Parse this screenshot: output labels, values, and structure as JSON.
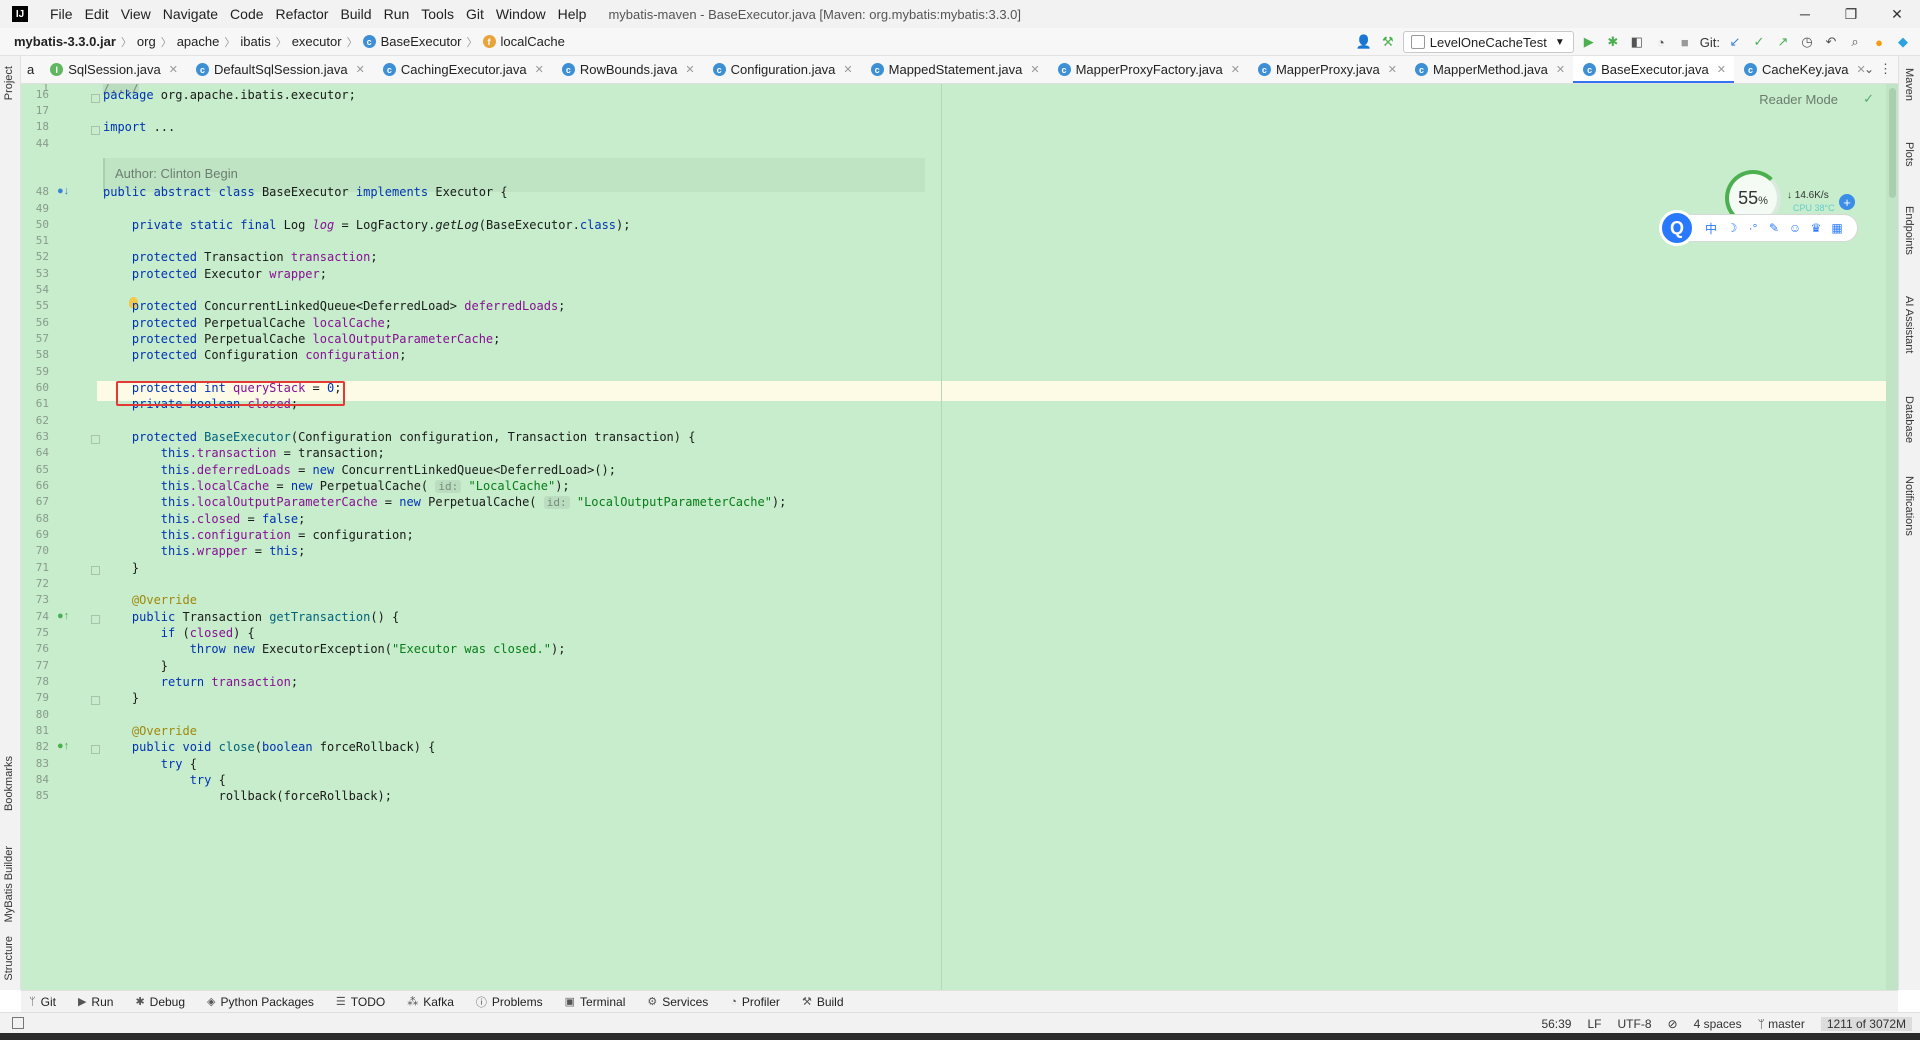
{
  "titlebar": {
    "logo": "IJ",
    "menu": [
      "File",
      "Edit",
      "View",
      "Navigate",
      "Code",
      "Refactor",
      "Build",
      "Run",
      "Tools",
      "Git",
      "Window",
      "Help"
    ],
    "window_title": "mybatis-maven - BaseExecutor.java [Maven: org.mybatis:mybatis:3.3.0]",
    "minimize": "─",
    "restore": "❐",
    "close": "✕"
  },
  "breadcrumb": {
    "jar": "mybatis-3.3.0.jar",
    "parts": [
      "org",
      "apache",
      "ibatis",
      "executor"
    ],
    "class_name": "BaseExecutor",
    "field_name": "localCache"
  },
  "toolbar": {
    "run_config": "LevelOneCacheTest",
    "git_label": "Git:"
  },
  "left_tools": [
    "Project",
    "Bookmarks",
    "MyBatis Builder",
    "Structure"
  ],
  "right_tools": [
    "Maven",
    "Plots",
    "Endpoints",
    "AI Assistant",
    "Database",
    "Notifications"
  ],
  "tabs": {
    "fragment": "a",
    "items": [
      {
        "label": "SqlSession.java",
        "active": false
      },
      {
        "label": "DefaultSqlSession.java",
        "active": false
      },
      {
        "label": "CachingExecutor.java",
        "active": false
      },
      {
        "label": "RowBounds.java",
        "active": false
      },
      {
        "label": "Configuration.java",
        "active": false
      },
      {
        "label": "MappedStatement.java",
        "active": false
      },
      {
        "label": "MapperProxyFactory.java",
        "active": false
      },
      {
        "label": "MapperProxy.java",
        "active": false
      },
      {
        "label": "MapperMethod.java",
        "active": false
      },
      {
        "label": "BaseExecutor.java",
        "active": true
      },
      {
        "label": "CacheKey.java",
        "active": false
      }
    ]
  },
  "editor": {
    "reader_mode": "Reader Mode",
    "author": "Author: Clinton Begin",
    "line_numbers": {
      "l1": "1",
      "l16": "16",
      "l17": "17",
      "l18": "18",
      "l44": "44",
      "l48": "48",
      "l49": "49",
      "l50": "50",
      "l51": "51",
      "l52": "52",
      "l53": "53",
      "l54": "54",
      "l55": "55",
      "l56": "56",
      "l57": "57",
      "l58": "58",
      "l59": "59",
      "l60": "60",
      "l61": "61",
      "l62": "62",
      "l63": "63",
      "l64": "64",
      "l65": "65",
      "l66": "66",
      "l67": "67",
      "l68": "68",
      "l69": "69",
      "l70": "70",
      "l71": "71",
      "l72": "72",
      "l73": "73",
      "l74": "74",
      "l75": "75",
      "l76": "76",
      "l77": "77",
      "l78": "78",
      "l79": "79",
      "l80": "80",
      "l81": "81",
      "l82": "82",
      "l83": "83",
      "l84": "84",
      "l85": "85"
    },
    "code": {
      "c1": "/.../",
      "c16_kw": "package",
      "c16_rest": " org.apache.ibatis.executor;",
      "c18_kw": "import",
      "c18_rest": " ...",
      "c48_kw1": "public abstract class",
      "c48_mid": " BaseExecutor ",
      "c48_kw2": "implements",
      "c48_rest": " Executor {",
      "c50_kw": "private static final",
      "c50_type": " Log ",
      "c50_fld": "log",
      "c50_eq": " = LogFactory.",
      "c50_m": "getLog",
      "c50_arg": "(BaseExecutor.",
      "c50_kw2": "class",
      "c50_end": ");",
      "c52_kw": "protected",
      "c52_type": " Transaction ",
      "c52_fld": "transaction",
      "c52_end": ";",
      "c53_kw": "protected",
      "c53_type": " Executor ",
      "c53_fld": "wrapper",
      "c53_end": ";",
      "c55_kw": "protected",
      "c55_type": " ConcurrentLinkedQueue<DeferredLoad> ",
      "c55_fld": "deferredLoads",
      "c55_end": ";",
      "c56_kw": "protected",
      "c56_type": " PerpetualCache ",
      "c56_fld": "localCache",
      "c56_end": ";",
      "c57_kw": "protected",
      "c57_type": " PerpetualCache ",
      "c57_fld": "localOutputParameterCache",
      "c57_end": ";",
      "c58_kw": "protected",
      "c58_type": " Configuration ",
      "c58_fld": "configuration",
      "c58_end": ";",
      "c60_kw": "protected int",
      "c60_fld": " queryStack",
      "c60_eq": " = ",
      "c60_num": "0",
      "c60_end": ";",
      "c61_kw": "private boolean",
      "c61_fld": " closed",
      "c61_end": ";",
      "c63_kw": "protected",
      "c63_m": " BaseExecutor",
      "c63_rest": "(Configuration configuration, Transaction transaction) {",
      "c64_kw": "this",
      "c64_fld": ".transaction",
      "c64_rest": " = transaction;",
      "c65_kw": "this",
      "c65_fld": ".deferredLoads",
      "c65_eq": " = ",
      "c65_kw2": "new",
      "c65_rest": " ConcurrentLinkedQueue<DeferredLoad>();",
      "c66_kw": "this",
      "c66_fld": ".localCache",
      "c66_eq": " = ",
      "c66_kw2": "new",
      "c66_rest": " PerpetualCache( ",
      "c66_hint": "id:",
      "c66_str": " \"LocalCache\"",
      "c66_end": ");",
      "c67_kw": "this",
      "c67_fld": ".localOutputParameterCache",
      "c67_eq": " = ",
      "c67_kw2": "new",
      "c67_rest": " PerpetualCache( ",
      "c67_hint": "id:",
      "c67_str": " \"LocalOutputParameterCache\"",
      "c67_end": ");",
      "c68_kw": "this",
      "c68_fld": ".closed",
      "c68_eq": " = ",
      "c68_kw2": "false",
      "c68_end": ";",
      "c69_kw": "this",
      "c69_fld": ".configuration",
      "c69_rest": " = configuration;",
      "c70_kw": "this",
      "c70_fld": ".wrapper",
      "c70_eq": " = ",
      "c70_kw2": "this",
      "c70_end": ";",
      "c71": "}",
      "c73": "@Override",
      "c74_kw": "public",
      "c74_type": " Transaction ",
      "c74_m": "getTransaction",
      "c74_end": "() {",
      "c75_kw": "if",
      "c75_p1": " (",
      "c75_fld": "closed",
      "c75_end": ") {",
      "c76_kw": "throw new",
      "c76_rest": " ExecutorException(",
      "c76_str": "\"Executor was closed.\"",
      "c76_end": ");",
      "c77": "}",
      "c78_kw": "return",
      "c78_fld": " transaction",
      "c78_end": ";",
      "c79": "}",
      "c81": "@Override",
      "c82_kw": "public void",
      "c82_m": " close",
      "c82_p": "(",
      "c82_kw2": "boolean",
      "c82_end": " forceRollback) {",
      "c83_kw": "try",
      "c83_end": " {",
      "c84_kw": "try",
      "c84_end": " {",
      "c85": "rollback(forceRollback);"
    }
  },
  "widget": {
    "percent": "55",
    "percent_unit": "%",
    "speed": "↓ 14.6K/s",
    "cpu": "CPU 38°C",
    "logo": "Q",
    "icons": [
      "中",
      "☽",
      "·°",
      "✎",
      "☺",
      "♛",
      "▦"
    ]
  },
  "toolwindows": [
    {
      "icon": "ᛘ",
      "label": "Git"
    },
    {
      "icon": "▶",
      "label": "Run"
    },
    {
      "icon": "✱",
      "label": "Debug"
    },
    {
      "icon": "◈",
      "label": "Python Packages"
    },
    {
      "icon": "☰",
      "label": "TODO"
    },
    {
      "icon": "⁂",
      "label": "Kafka"
    },
    {
      "icon": "ⓘ",
      "label": "Problems"
    },
    {
      "icon": "▣",
      "label": "Terminal"
    },
    {
      "icon": "⚙",
      "label": "Services"
    },
    {
      "icon": "◔",
      "label": "Profiler"
    },
    {
      "icon": "⚒",
      "label": "Build"
    }
  ],
  "status": {
    "position": "56:39",
    "line_sep": "LF",
    "encoding": "UTF-8",
    "indent": "4 spaces",
    "branch": "master",
    "memory": "1211 of 3072M"
  },
  "colors": {
    "editor_bg": "#c7edcc",
    "keyword": "#0033b3",
    "field": "#871094",
    "string": "#067d17",
    "annotation": "#9e880d",
    "highlight_box": "#e53935",
    "tab_underline": "#3574f0"
  }
}
